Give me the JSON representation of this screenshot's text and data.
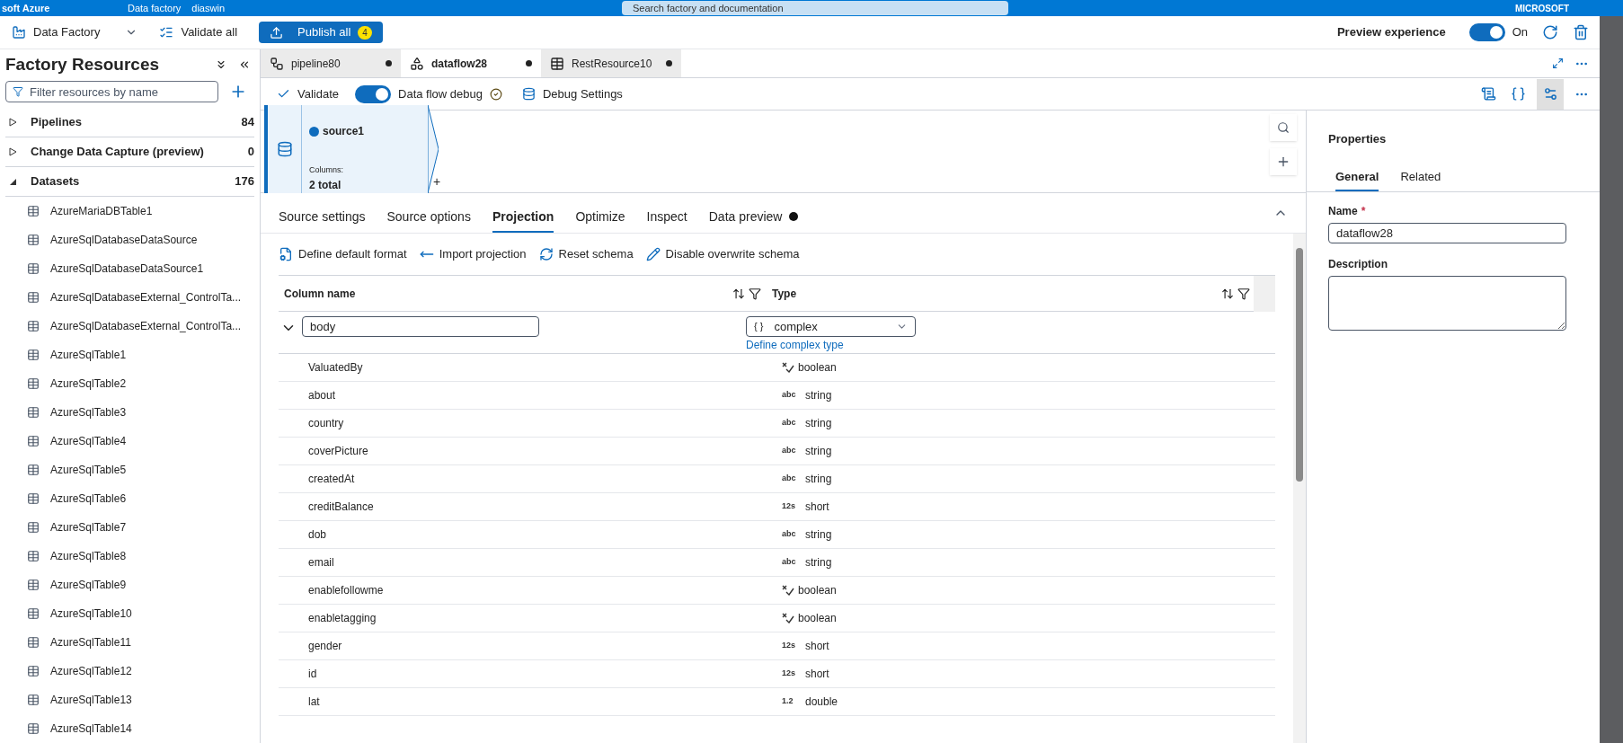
{
  "header": {
    "brand": "soft Azure",
    "breadcrumb": [
      "Data factory",
      "diaswin"
    ],
    "search": {
      "placeholder": "Search factory and documentation"
    },
    "account": "MICROSOFT"
  },
  "toolbar": {
    "factory": "Data Factory",
    "validate_all": "Validate all",
    "publish": {
      "label": "Publish all",
      "count": "4"
    },
    "preview": {
      "label": "Preview experience",
      "on": true,
      "state": "On"
    }
  },
  "sidebar": {
    "title": "Factory Resources",
    "filter": {
      "placeholder": "Filter resources by name"
    },
    "sections": [
      {
        "label": "Pipelines",
        "count": "84",
        "expanded": false
      },
      {
        "label": "Change Data Capture (preview)",
        "count": "0",
        "expanded": false
      },
      {
        "label": "Datasets",
        "count": "176",
        "expanded": true,
        "children": [
          "AzureMariaDBTable1",
          "AzureSqlDatabaseDataSource",
          "AzureSqlDatabaseDataSource1",
          "AzureSqlDatabaseExternal_ControlTa...",
          "AzureSqlDatabaseExternal_ControlTa...",
          "AzureSqlTable1",
          "AzureSqlTable2",
          "AzureSqlTable3",
          "AzureSqlTable4",
          "AzureSqlTable5",
          "AzureSqlTable6",
          "AzureSqlTable7",
          "AzureSqlTable8",
          "AzureSqlTable9",
          "AzureSqlTable10",
          "AzureSqlTable11",
          "AzureSqlTable12",
          "AzureSqlTable13",
          "AzureSqlTable14"
        ]
      }
    ]
  },
  "tabs": [
    {
      "label": "pipeline80",
      "kind": "pipeline",
      "selected": false,
      "unsaved": true
    },
    {
      "label": "dataflow28",
      "kind": "dataflow",
      "selected": true,
      "unsaved": true
    },
    {
      "label": "RestResource10",
      "kind": "dataset",
      "selected": false,
      "unsaved": true
    }
  ],
  "editor_toolbar": {
    "validate": "Validate",
    "debug": {
      "label": "Data flow debug",
      "on": true,
      "ready": true
    },
    "debug_settings": "Debug Settings"
  },
  "canvas": {
    "node": {
      "name": "source1",
      "columns_label": "Columns:",
      "columns": "2 total",
      "add": "+"
    }
  },
  "config_tabs": [
    {
      "label": "Source settings",
      "selected": false,
      "dot": false
    },
    {
      "label": "Source options",
      "selected": false,
      "dot": false
    },
    {
      "label": "Projection",
      "selected": true,
      "dot": false
    },
    {
      "label": "Optimize",
      "selected": false,
      "dot": false
    },
    {
      "label": "Inspect",
      "selected": false,
      "dot": false
    },
    {
      "label": "Data preview",
      "selected": false,
      "dot": true
    }
  ],
  "actions": [
    {
      "label": "Define default format",
      "kind": "format"
    },
    {
      "label": "Import projection",
      "kind": "import"
    },
    {
      "label": "Reset schema",
      "kind": "reset"
    },
    {
      "label": "Disable overwrite schema",
      "kind": "edit"
    }
  ],
  "table": {
    "columns": [
      "Column name",
      "Type"
    ],
    "parent": {
      "name": "body",
      "type": "complex",
      "tag": "{ }",
      "expanded": true,
      "link": "Define complex type"
    },
    "rows": [
      {
        "name": "ValuatedBy",
        "kind": "boolean",
        "tag": "",
        "type": "boolean"
      },
      {
        "name": "about",
        "kind": "text",
        "tag": "abc",
        "type": "string"
      },
      {
        "name": "country",
        "kind": "text",
        "tag": "abc",
        "type": "string"
      },
      {
        "name": "coverPicture",
        "kind": "text",
        "tag": "abc",
        "type": "string"
      },
      {
        "name": "createdAt",
        "kind": "text",
        "tag": "abc",
        "type": "string"
      },
      {
        "name": "creditBalance",
        "kind": "text",
        "tag": "12s",
        "type": "short"
      },
      {
        "name": "dob",
        "kind": "text",
        "tag": "abc",
        "type": "string"
      },
      {
        "name": "email",
        "kind": "text",
        "tag": "abc",
        "type": "string"
      },
      {
        "name": "enablefollowme",
        "kind": "boolean",
        "tag": "",
        "type": "boolean"
      },
      {
        "name": "enabletagging",
        "kind": "boolean",
        "tag": "",
        "type": "boolean"
      },
      {
        "name": "gender",
        "kind": "text",
        "tag": "12s",
        "type": "short"
      },
      {
        "name": "id",
        "kind": "text",
        "tag": "12s",
        "type": "short"
      },
      {
        "name": "lat",
        "kind": "text",
        "tag": "1.2",
        "type": "double"
      }
    ]
  },
  "properties": {
    "title": "Properties",
    "tabs": [
      {
        "label": "General",
        "selected": true
      },
      {
        "label": "Related",
        "selected": false
      }
    ],
    "name": {
      "label": "Name",
      "required": true,
      "mark": "*",
      "value": "dataflow28"
    },
    "description": {
      "label": "Description"
    }
  }
}
